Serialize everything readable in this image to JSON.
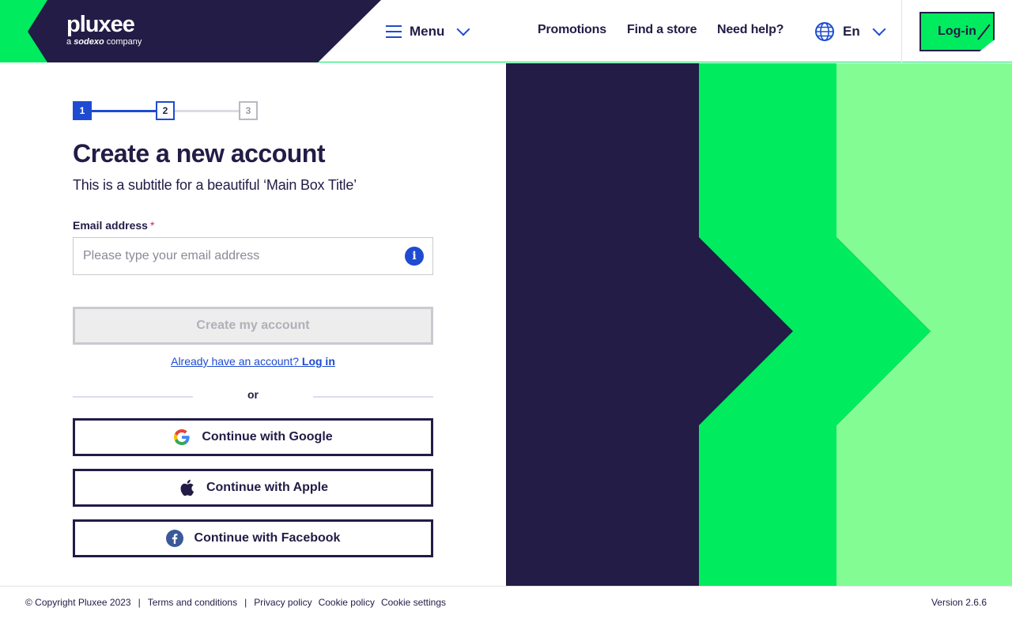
{
  "header": {
    "logo_text": "pluxee",
    "logo_sub_prefix": "a",
    "logo_sub_brand": "sodexo",
    "logo_sub_suffix": "company",
    "menu_label": "Menu",
    "nav": [
      "Promotions",
      "Find a store",
      "Need help?"
    ],
    "language": "En",
    "login_label": "Log-in"
  },
  "stepper": {
    "steps": [
      "1",
      "2",
      "3"
    ],
    "current": 1
  },
  "main": {
    "title": "Create a new account",
    "subtitle": "This is a subtitle for a beautiful ‘Main Box Title’",
    "email_label": "Email address",
    "email_required_mark": "*",
    "email_placeholder": "Please type your email address",
    "email_value": "",
    "info_icon": "i",
    "create_button": "Create my account",
    "already_prefix": "Already have an account?",
    "already_link": "Log in",
    "or_text": "or",
    "social": [
      {
        "label": "Continue with Google",
        "icon": "google-icon"
      },
      {
        "label": "Continue with Apple",
        "icon": "apple-icon"
      },
      {
        "label": "Continue with Facebook",
        "icon": "facebook-icon"
      }
    ]
  },
  "footer": {
    "copyright": "© Copyright Pluxee 2023",
    "terms": "Terms and conditions",
    "privacy": "Privacy policy",
    "cookie_policy": "Cookie policy",
    "cookie_settings": "Cookie settings",
    "version": "Version 2.6.6"
  },
  "colors": {
    "brand_dark": "#221c46",
    "brand_green": "#00eb5e",
    "brand_light_green": "#84fc94",
    "accent_blue": "#1e4bd2",
    "required_pink": "#e0176a"
  }
}
